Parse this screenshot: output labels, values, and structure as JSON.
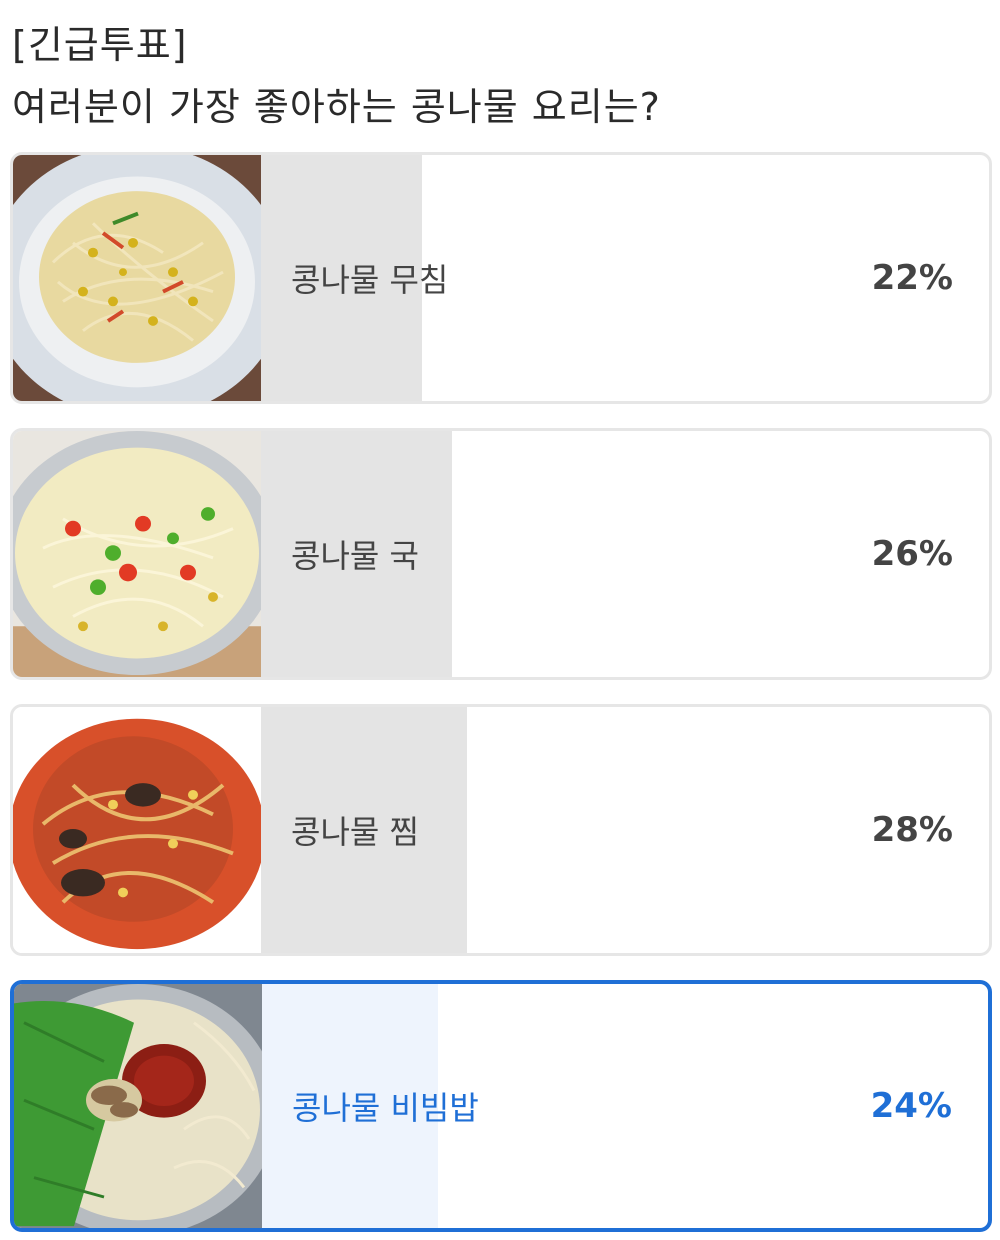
{
  "poll": {
    "tag": "[긴급투표]",
    "question": "여러분이 가장 좋아하는 콩나물 요리는?",
    "accent_color": "#1f6fd6",
    "options": [
      {
        "label": "콩나물 무침",
        "percent_text": "22%",
        "percent": 22,
        "selected": false,
        "image": "seasoned-bean-sprouts-image"
      },
      {
        "label": "콩나물 국",
        "percent_text": "26%",
        "percent": 26,
        "selected": false,
        "image": "bean-sprout-soup-image"
      },
      {
        "label": "콩나물 찜",
        "percent_text": "28%",
        "percent": 28,
        "selected": false,
        "image": "braised-bean-sprouts-image"
      },
      {
        "label": "콩나물 비빔밥",
        "percent_text": "24%",
        "percent": 24,
        "selected": true,
        "image": "bean-sprout-bibimbap-image"
      }
    ]
  }
}
